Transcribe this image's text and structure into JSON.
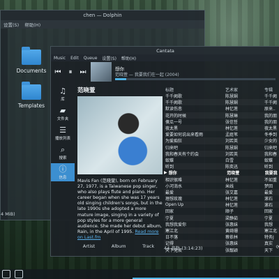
{
  "dolphin": {
    "title": "chen — Dolphin",
    "menu": [
      "设置(S)",
      "帮助(H)"
    ],
    "folders": [
      "Documents",
      "Templates"
    ],
    "status": "4 MiB)"
  },
  "cantata": {
    "title": "Cantata",
    "menu": [
      "Music",
      "Edit",
      "Queue",
      "设置(S)",
      "帮助(H)"
    ],
    "now_playing": {
      "title": "想你",
      "subtitle": "范晓萱 — 我要我们在一起 (2004)",
      "progress": 0.07
    },
    "sidebar": [
      {
        "label": "库",
        "icon": "music-note-icon"
      },
      {
        "label": "文件夹",
        "icon": "folder-icon"
      },
      {
        "label": "播放列表",
        "icon": "list-icon"
      },
      {
        "label": "搜索",
        "icon": "search-icon"
      },
      {
        "label": "信息",
        "icon": "info-icon"
      }
    ],
    "artist": "范晓萱",
    "bio": "Mavis Fan (范晓萱), born on February 27, 1977, is a Taiwanese pop singer, who also plays flute and piano. Her career began when she was 17 years old singing children's songs, but in the late 1990s she adopted a more mature image, singing in a variety of pop styles for a more general audience. She made her debut album, Rain, in the April of 1995. ",
    "bio_link": "Read more on Last.fm",
    "bottom_tabs": [
      "Artist",
      "Album",
      "Track"
    ],
    "columns": [
      "标题",
      "艺术家",
      "专辑"
    ],
    "tracks": [
      [
        "千千阙歌",
        "陈慧娴",
        "千千阙"
      ],
      [
        "千千阙歌",
        "陈慧娴",
        "千千阙"
      ],
      [
        "默读伤悲",
        "林忆莲",
        "原来.."
      ],
      [
        "花开的时候",
        "陈慧琳",
        "我的朋"
      ],
      [
        "傻瓜一号",
        "张信哲",
        "我的朋"
      ],
      [
        "夜太黑",
        "林忆莲",
        "夜太黑"
      ],
      [
        "爱要如何说出来看雨",
        "孟庭苇",
        "冬季到"
      ],
      [
        "为爱痴狂",
        "刘若英",
        "少女的"
      ],
      [
        "归来吧",
        "陈慧娴",
        "归来吧"
      ],
      [
        "我和春天有个约会",
        "刘若英",
        "我和春"
      ],
      [
        "蚁蝶",
        "白雪",
        "蚁蝶"
      ],
      [
        "听到",
        "陈奕迅",
        "听到"
      ],
      [
        "想你",
        "范晓萱",
        "我要我"
      ],
      [
        "相识很难",
        "林忆莲",
        "不如重"
      ],
      [
        "小河淌水",
        "米线",
        "梦回"
      ],
      [
        "最爱",
        "张艾嘉",
        "最爱"
      ],
      [
        "理想玫瑰",
        "林忆莲",
        "滚石"
      ],
      [
        "Open Up",
        "林忆莲",
        "滚石"
      ],
      [
        "回家",
        "顺子",
        "回家"
      ],
      [
        "宁夏",
        "梁静茹",
        "宁夏"
      ],
      [
        "我想我爱你",
        "张惠妹",
        "我想"
      ],
      [
        "寒江北",
        "黄绮珊",
        "寒江北"
      ],
      [
        "日不落",
        "蔡依林",
        "特务J"
      ],
      [
        "记得",
        "张惠妹",
        "真实"
      ],
      [
        "天下无双",
        "张靓颖",
        "天下"
      ]
    ],
    "playing_index": 12,
    "footer_count": "44 音轨 (3:14:23)"
  },
  "colors": {
    "accent": "#3c8fd0",
    "progress": "#4fb2e3",
    "link": "#5ab2ee"
  }
}
